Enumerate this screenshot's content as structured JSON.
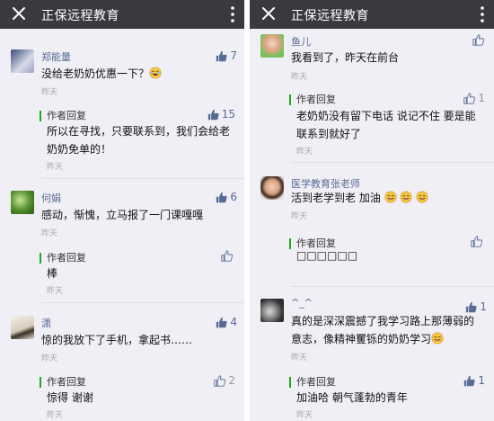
{
  "left_pane": {
    "title": "正保远程教育",
    "comments": [
      {
        "user": "郑能量",
        "text": "没给老奶奶优惠一下？",
        "emoji": "laughing-emoji",
        "time": "昨天",
        "likes": "7",
        "reply": {
          "label": "作者回复",
          "text": "所以在寻找，只要联系到，我们会给老奶奶免单的！",
          "time": "昨天",
          "likes": "15"
        }
      },
      {
        "user": "何娟",
        "text": "感动，惭愧，立马报了一门课嘎嘎",
        "time": "昨天",
        "likes": "6",
        "reply": {
          "label": "作者回复",
          "text": "棒",
          "time": "昨天",
          "likes": ""
        }
      },
      {
        "user": "潇",
        "text": "惊的我放下了手机，拿起书……",
        "time": "昨天",
        "likes": "4",
        "reply": {
          "label": "作者回复",
          "text": "惊得 谢谢",
          "time": "昨天",
          "likes": "2"
        }
      }
    ]
  },
  "right_pane": {
    "title": "正保远程教育",
    "comments": [
      {
        "user": "鱼儿",
        "text": "我看到了，昨天在前台",
        "time": "昨天",
        "likes": "",
        "reply": {
          "label": "作者回复",
          "text": "老奶奶没有留下电话 说记不住 要是能联系到就好了",
          "time": "昨天",
          "likes": "1"
        }
      },
      {
        "user": "医学教育张老师",
        "text": "活到老学到老 加油",
        "emoji": "grin-emoji-x3",
        "time": "昨天",
        "likes": "",
        "reply": {
          "label": "作者回复",
          "text": "□□□□□□",
          "time": "",
          "likes": ""
        }
      },
      {
        "user": "^_^",
        "text": "真的是深深震撼了我学习路上那薄弱的意志，像精神矍铄的奶奶学习",
        "emoji": "grin-emoji",
        "time": "昨天",
        "likes": "1",
        "reply": {
          "label": "作者回复",
          "text": "加油哈 朝气蓬勃的青年",
          "time": "昨天",
          "likes": "1"
        }
      }
    ]
  },
  "colors": {
    "topbar": "#393a3f",
    "nickname": "#576b95",
    "reply_bar": "#1aad19",
    "background": "#f0eff5"
  }
}
